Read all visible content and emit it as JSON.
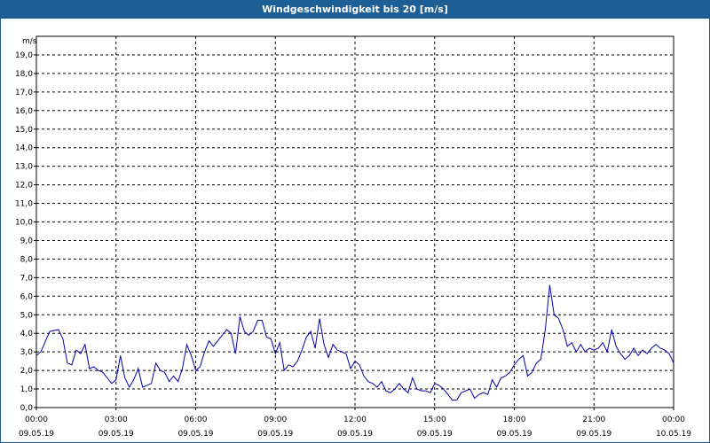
{
  "window": {
    "title": "Windgeschwindigkeit bis 20 [m/s]"
  },
  "chart_data": {
    "type": "line",
    "title": "Windgeschwindigkeit bis 20 [m/s]",
    "ylabel": "m/s",
    "ylim": [
      0,
      20
    ],
    "yticks": [
      "0,0",
      "1,0",
      "2,0",
      "3,0",
      "4,0",
      "5,0",
      "6,0",
      "7,0",
      "8,0",
      "9,0",
      "10,0",
      "11,0",
      "12,0",
      "13,0",
      "14,0",
      "15,0",
      "16,0",
      "17,0",
      "18,0",
      "19,0"
    ],
    "xlim": [
      "09.05.19 00:00",
      "10.05.19 00:00"
    ],
    "xticks": [
      {
        "time": "00:00",
        "date": "09.05.19"
      },
      {
        "time": "03:00",
        "date": "09.05.19"
      },
      {
        "time": "06:00",
        "date": "09.05.19"
      },
      {
        "time": "09:00",
        "date": "09.05.19"
      },
      {
        "time": "12:00",
        "date": "09.05.19"
      },
      {
        "time": "15:00",
        "date": "09.05.19"
      },
      {
        "time": "18:00",
        "date": "09.05.19"
      },
      {
        "time": "21:00",
        "date": "09.05.19"
      },
      {
        "time": "00:00",
        "date": "10.05.19"
      }
    ],
    "grid": true,
    "line_color": "#0000aa",
    "series": [
      {
        "x": [
          "00:00",
          "00:10",
          "00:30",
          "00:50",
          "01:00",
          "01:10",
          "01:20",
          "01:30",
          "01:40",
          "01:50",
          "02:00",
          "02:10",
          "02:20",
          "02:30",
          "02:40",
          "02:50",
          "03:00",
          "03:10",
          "03:20",
          "03:30",
          "03:40",
          "03:50",
          "04:00",
          "04:10",
          "04:20",
          "04:30",
          "04:40",
          "04:50",
          "05:00",
          "05:10",
          "05:20",
          "05:30",
          "05:40",
          "05:50",
          "06:00",
          "06:10",
          "06:20",
          "06:30",
          "06:40",
          "06:50",
          "07:00",
          "07:10",
          "07:20",
          "07:30",
          "07:40",
          "07:50",
          "08:00",
          "08:10",
          "08:20",
          "08:30",
          "08:40",
          "08:50",
          "09:00",
          "09:10",
          "09:20",
          "09:30",
          "09:40",
          "09:50",
          "10:00",
          "10:10",
          "10:20",
          "10:30",
          "10:40",
          "10:50",
          "11:00",
          "11:10",
          "11:20",
          "11:30",
          "11:40",
          "11:50",
          "12:00",
          "12:10",
          "12:20",
          "12:30",
          "12:40",
          "12:50",
          "13:00",
          "13:10",
          "13:20",
          "13:30",
          "13:40",
          "13:50",
          "14:00",
          "14:10",
          "14:20",
          "14:30",
          "14:40",
          "14:50",
          "15:00",
          "15:10",
          "15:20",
          "15:30",
          "15:40",
          "15:50",
          "16:00",
          "16:10",
          "16:20",
          "16:30",
          "16:40",
          "16:50",
          "17:00",
          "17:10",
          "17:20",
          "17:30",
          "17:40",
          "17:50",
          "18:00",
          "18:10",
          "18:20",
          "18:30",
          "18:40",
          "18:50",
          "19:00",
          "19:10",
          "19:20",
          "19:30",
          "19:40",
          "19:50",
          "20:00",
          "20:10",
          "20:20",
          "20:30",
          "20:40",
          "20:50",
          "21:00",
          "21:10",
          "21:20",
          "21:30",
          "21:40",
          "21:50",
          "22:00",
          "22:10",
          "22:20",
          "22:30",
          "22:40",
          "22:50",
          "23:00",
          "23:10",
          "23:20",
          "23:30",
          "23:40",
          "23:50",
          "24:00"
        ],
        "y": [
          2.8,
          3.0,
          4.1,
          4.2,
          3.7,
          2.4,
          2.3,
          3.1,
          2.9,
          3.4,
          2.1,
          2.2,
          2.0,
          1.9,
          1.6,
          1.3,
          1.5,
          2.8,
          1.6,
          1.1,
          1.5,
          2.1,
          1.1,
          1.2,
          1.3,
          2.4,
          2.0,
          1.9,
          1.4,
          1.7,
          1.4,
          2.1,
          3.4,
          2.8,
          2.0,
          2.2,
          3.0,
          3.6,
          3.3,
          3.6,
          3.9,
          4.2,
          4.0,
          2.9,
          4.9,
          4.1,
          3.9,
          4.1,
          4.7,
          4.7,
          3.8,
          3.7,
          2.9,
          3.5,
          2.0,
          2.3,
          2.2,
          2.5,
          3.1,
          3.8,
          4.1,
          3.2,
          4.8,
          3.4,
          2.7,
          3.4,
          3.1,
          3.0,
          2.9,
          2.1,
          2.5,
          2.3,
          1.7,
          1.4,
          1.3,
          1.1,
          1.4,
          0.9,
          0.8,
          1.0,
          1.3,
          1.0,
          0.8,
          1.6,
          1.0,
          0.9,
          0.9,
          0.8,
          1.3,
          1.2,
          1.0,
          0.7,
          0.4,
          0.4,
          0.8,
          0.9,
          1.0,
          0.5,
          0.7,
          0.8,
          0.7,
          1.5,
          1.1,
          1.6,
          1.7,
          1.9,
          2.3,
          2.6,
          2.8,
          1.7,
          1.9,
          2.4,
          2.6,
          4.2,
          6.6,
          5.0,
          4.8,
          4.2,
          3.3,
          3.5,
          3.0,
          3.4,
          3.0,
          3.2,
          3.1,
          3.2,
          3.5,
          3.0,
          4.2,
          3.3,
          2.9,
          2.6,
          2.8,
          3.2,
          2.8,
          3.1,
          2.9,
          3.2,
          3.4,
          3.2,
          3.1,
          2.9,
          2.4
        ]
      }
    ]
  }
}
